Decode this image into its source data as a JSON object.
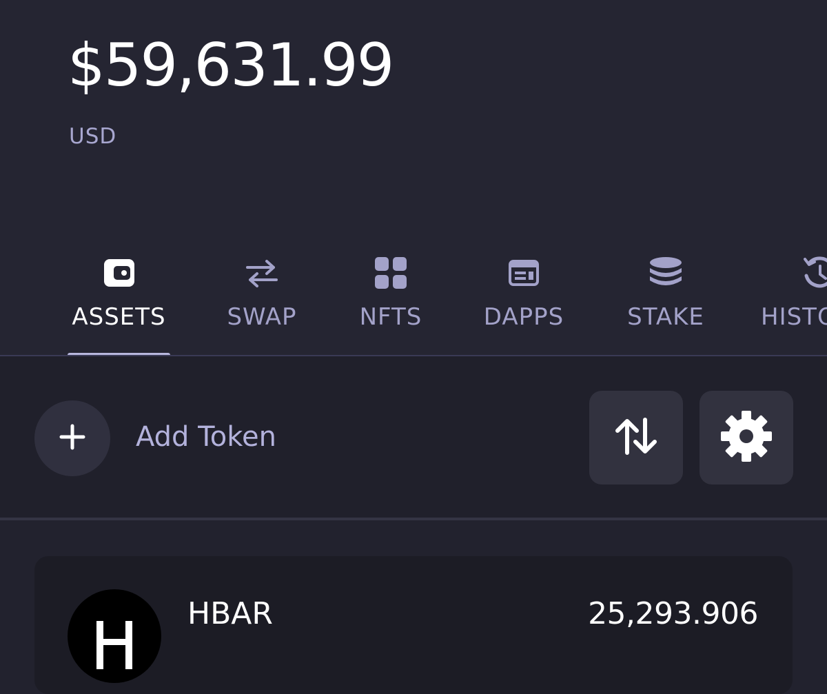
{
  "balance": {
    "amount": "$59,631.99",
    "currency": "USD"
  },
  "tabs": [
    {
      "label": "ASSETS",
      "icon": "wallet-icon",
      "active": true
    },
    {
      "label": "SWAP",
      "icon": "swap-arrows-icon",
      "active": false
    },
    {
      "label": "NFTS",
      "icon": "grid-icon",
      "active": false
    },
    {
      "label": "DAPPS",
      "icon": "browser-window-icon",
      "active": false
    },
    {
      "label": "STAKE",
      "icon": "coin-stack-icon",
      "active": false
    },
    {
      "label": "HISTO",
      "icon": "history-icon",
      "active": false
    }
  ],
  "actions": {
    "add_token_label": "Add Token",
    "add_icon": "plus-icon",
    "sort_icon": "sort-arrows-icon",
    "settings_icon": "gear-icon"
  },
  "tokens": [
    {
      "symbol": "HBAR",
      "balance": "25,293.906",
      "logo_letter": "H",
      "icon": "hbar-logo-icon"
    }
  ],
  "colors": {
    "background": "#22222e",
    "header_background": "#252532",
    "accent_text": "#a8a7d0",
    "active_text": "#ffffff",
    "button_background": "#32323f"
  }
}
